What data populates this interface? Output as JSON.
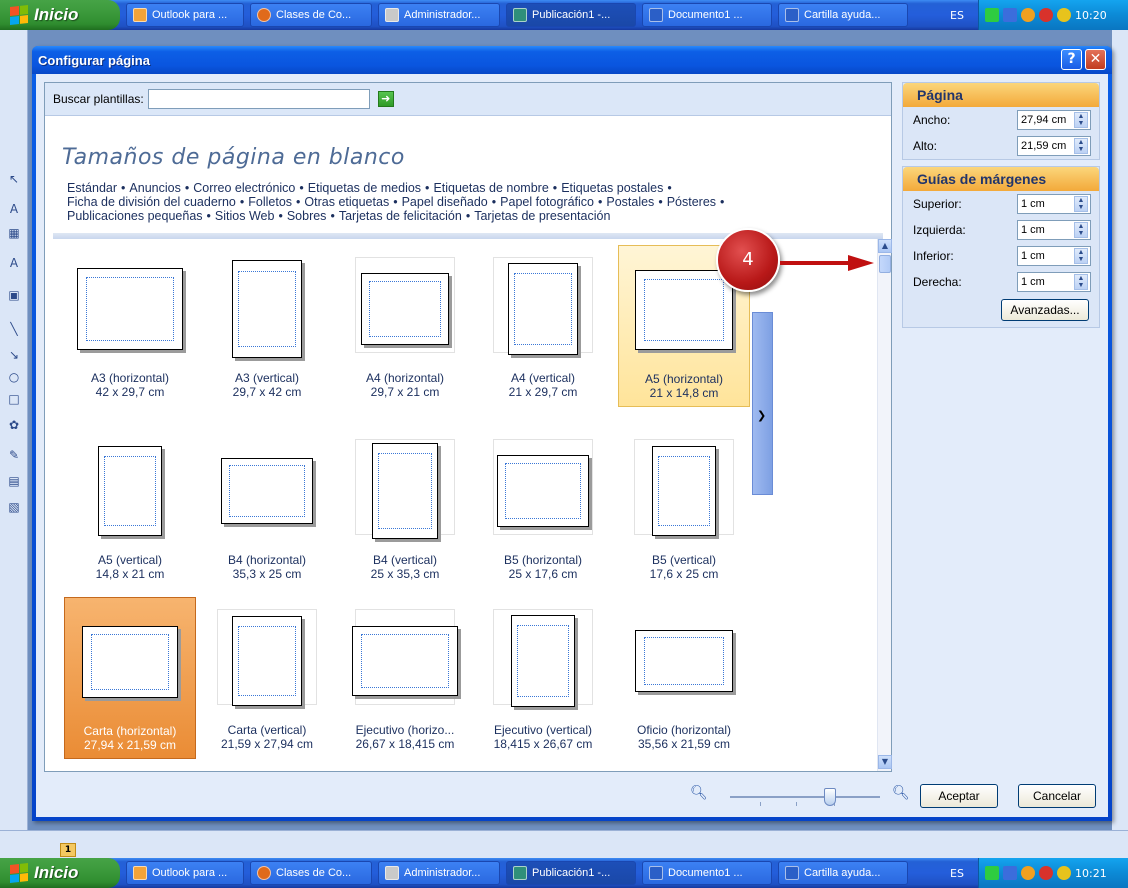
{
  "taskbar_top": {
    "start_label": "Inicio",
    "tasks": [
      "Outlook para ...",
      "Clases de Co...",
      "Administrador...",
      "Publicación1 -...",
      "Documento1 ...",
      "Cartilla ayuda..."
    ],
    "lang": "ES",
    "clock": "10:20"
  },
  "taskbar_bottom": {
    "start_label": "Inicio",
    "tasks": [
      "Outlook para ...",
      "Clases de Co...",
      "Administrador...",
      "Publicación1 -...",
      "Documento1 ...",
      "Cartilla ayuda..."
    ],
    "lang": "ES",
    "clock": "10:21"
  },
  "page_marker": "1",
  "dialog": {
    "title": "Configurar página",
    "search": {
      "label": "Buscar plantillas:",
      "value": ""
    },
    "heading": "Tamaños de página en blanco",
    "categories": [
      "Estándar",
      "Anuncios",
      "Correo electrónico",
      "Etiquetas de medios",
      "Etiquetas de nombre",
      "Etiquetas postales",
      "Ficha de división del cuaderno",
      "Folletos",
      "Otras etiquetas",
      "Papel diseñado",
      "Papel fotográfico",
      "Postales",
      "Pósteres",
      "Publicaciones pequeñas",
      "Sitios Web",
      "Sobres",
      "Tarjetas de felicitación",
      "Tarjetas de presentación"
    ],
    "sizes": [
      {
        "name": "A3 (horizontal)",
        "dims": "42 x 29,7 cm"
      },
      {
        "name": "A3 (vertical)",
        "dims": "29,7 x 42 cm"
      },
      {
        "name": "A4 (horizontal)",
        "dims": "29,7 x 21 cm"
      },
      {
        "name": "A4 (vertical)",
        "dims": "21 x 29,7 cm"
      },
      {
        "name": "A5 (horizontal)",
        "dims": "21 x 14,8 cm"
      },
      {
        "name": "A5 (vertical)",
        "dims": "14,8 x 21 cm"
      },
      {
        "name": "B4 (horizontal)",
        "dims": "35,3 x 25 cm"
      },
      {
        "name": "B4 (vertical)",
        "dims": "25 x 35,3 cm"
      },
      {
        "name": "B5 (horizontal)",
        "dims": "25 x 17,6 cm"
      },
      {
        "name": "B5 (vertical)",
        "dims": "17,6 x 25 cm"
      },
      {
        "name": "Carta (horizontal)",
        "dims": "27,94 x 21,59 cm"
      },
      {
        "name": "Carta (vertical)",
        "dims": "21,59 x 27,94 cm"
      },
      {
        "name": "Ejecutivo (horizo...",
        "dims": "26,67 x 18,415 cm"
      },
      {
        "name": "Ejecutivo (vertical)",
        "dims": "18,415 x 26,67 cm"
      },
      {
        "name": "Oficio (horizontal)",
        "dims": "35,56 x 21,59 cm"
      }
    ],
    "page_section": {
      "title": "Página",
      "width_label": "Ancho:",
      "width_value": "27,94 cm",
      "height_label": "Alto:",
      "height_value": "21,59 cm"
    },
    "margins_section": {
      "title": "Guías de márgenes",
      "top_label": "Superior:",
      "top_value": "1 cm",
      "left_label": "Izquierda:",
      "left_value": "1 cm",
      "bottom_label": "Inferior:",
      "bottom_value": "1 cm",
      "right_label": "Derecha:",
      "right_value": "1 cm",
      "advanced_label": "Avanzadas..."
    },
    "ok_label": "Aceptar",
    "cancel_label": "Cancelar"
  },
  "annotation": {
    "number": "4",
    "color": "#c01010"
  },
  "colors": {
    "selected_yellow": "#ffe49a",
    "selected_orange": "#ea8c35",
    "section_header": "#f3a93a",
    "titlebar": "#0a55df"
  }
}
